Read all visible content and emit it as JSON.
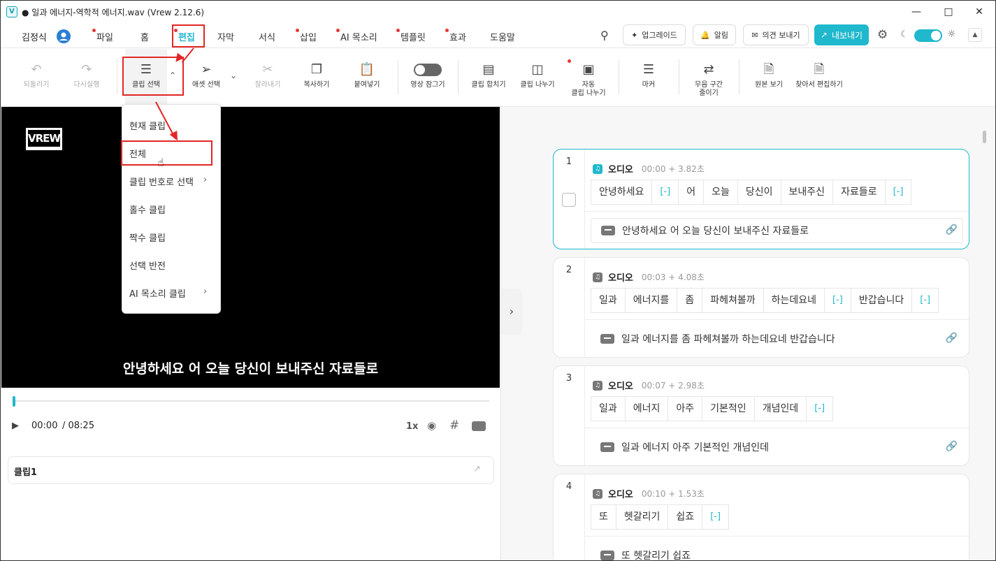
{
  "window": {
    "title": "● 일과 에너지-역학적 에너지.wav (Vrew 2.12.6)",
    "app_icon": "V"
  },
  "user": {
    "name": "김정식"
  },
  "menu": [
    {
      "label": "파일",
      "dot": true
    },
    {
      "label": "홈",
      "dot": false
    },
    {
      "label": "편집",
      "dot": true,
      "active": true
    },
    {
      "label": "자막",
      "dot": false
    },
    {
      "label": "서식",
      "dot": false
    },
    {
      "label": "삽입",
      "dot": true
    },
    {
      "label": "AI 목소리",
      "dot": true
    },
    {
      "label": "템플릿",
      "dot": true
    },
    {
      "label": "효과",
      "dot": true
    },
    {
      "label": "도움말",
      "dot": false
    }
  ],
  "top_buttons": {
    "upgrade": "업그레이드",
    "notify": "알림",
    "feedback": "의견 보내기",
    "export": "내보내기"
  },
  "toolbar": {
    "undo": "되돌리기",
    "redo": "다시실행",
    "clip_select": "클립 선택",
    "asset_select": "애셋 선택",
    "cut": "잘라내기",
    "copy": "복사하기",
    "paste": "붙여넣기",
    "video_lock": "영상 잠그기",
    "merge": "클립 합치기",
    "split": "클립 나누기",
    "auto_split_1": "자동",
    "auto_split_2": "클립 나누기",
    "marker": "마커",
    "silence_1": "무음 구간",
    "silence_2": "줄이기",
    "view_original": "원본 보기",
    "find_edit": "찾아서 편집하기"
  },
  "dropdown": {
    "items": [
      "현재 클립",
      "전체",
      "클립 번호로 선택",
      "홀수 클립",
      "짝수 클립",
      "선택 반전",
      "AI 목소리 클립"
    ]
  },
  "player": {
    "logo": "VREW",
    "subtitle": "안녕하세요 어 오늘 당신이 보내주신 자료들로",
    "current_time": "00:00",
    "total_time": "/ 08:25",
    "speed": "1x",
    "progress": 0.0,
    "clip_name": "클립1"
  },
  "clips": [
    {
      "num": "1",
      "label": "오디오",
      "time": "00:00 + 3.82초",
      "words": [
        "안녕하세요",
        "[-]",
        "어",
        "오늘",
        "당신이",
        "보내주신",
        "자료들로",
        "[-]"
      ],
      "subtitle": "안녕하세요 어 오늘 당신이 보내주신 자료들로"
    },
    {
      "num": "2",
      "label": "오디오",
      "time": "00:03 + 4.08초",
      "words": [
        "일과",
        "에너지를",
        "좀",
        "파헤쳐볼까",
        "하는데요네",
        "[-]",
        "반갑습니다",
        "[-]"
      ],
      "subtitle": "일과 에너지를 좀 파헤쳐볼까 하는데요네 반갑습니다"
    },
    {
      "num": "3",
      "label": "오디오",
      "time": "00:07 + 2.98초",
      "words": [
        "일과",
        "에너지",
        "아주",
        "기본적인",
        "개념인데",
        "[-]"
      ],
      "subtitle": "일과 에너지 아주 기본적인 개념인데"
    },
    {
      "num": "4",
      "label": "오디오",
      "time": "00:10 + 1.53초",
      "words": [
        "또",
        "헷갈리기",
        "쉽죠",
        "[-]"
      ],
      "subtitle": "또 헷갈리기 쉽죠"
    }
  ],
  "colors": {
    "accent": "#1fb8cc",
    "highlight": "#e32626"
  }
}
